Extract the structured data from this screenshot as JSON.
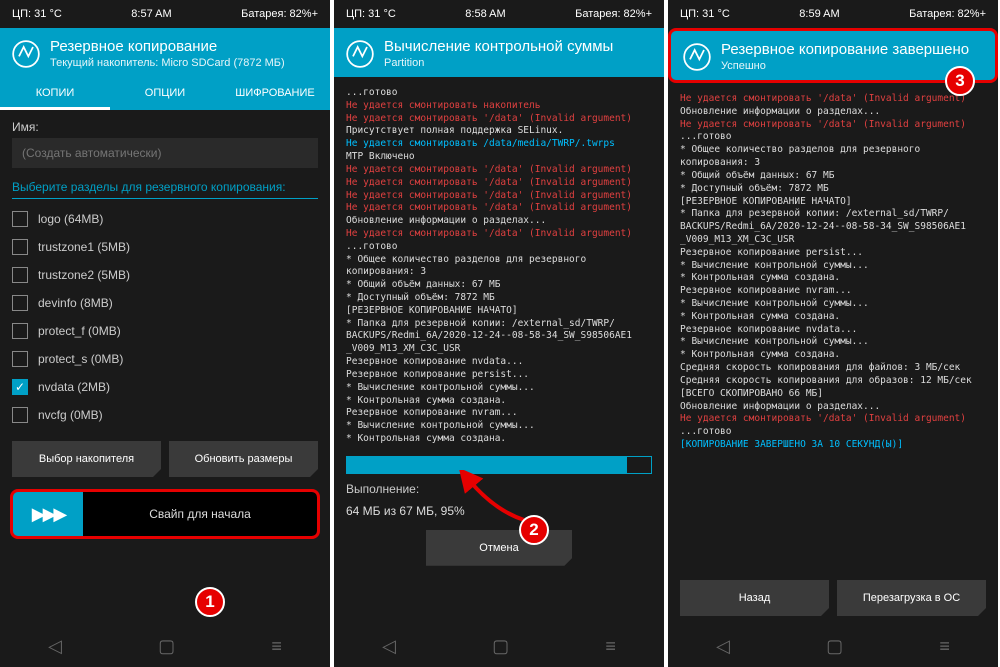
{
  "screens": [
    {
      "status": {
        "cpu": "ЦП: 31 °C",
        "time": "8:57 AM",
        "battery": "Батарея: 82%+"
      },
      "header": {
        "title": "Резервное копирование",
        "subtitle": "Текущий накопитель: Micro SDCard (7872 МБ)"
      },
      "tabs": [
        "КОПИИ",
        "ОПЦИИ",
        "ШИФРОВАНИЕ"
      ],
      "name_label": "Имя:",
      "name_placeholder": "(Создать автоматически)",
      "partitions_label": "Выберите разделы для резервного копирования:",
      "partitions": [
        {
          "label": "logo (64MB)",
          "checked": false
        },
        {
          "label": "trustzone1 (5MB)",
          "checked": false
        },
        {
          "label": "trustzone2 (5MB)",
          "checked": false
        },
        {
          "label": "devinfo (8MB)",
          "checked": false
        },
        {
          "label": "protect_f (0MB)",
          "checked": false
        },
        {
          "label": "protect_s (0MB)",
          "checked": false
        },
        {
          "label": "nvdata (2MB)",
          "checked": true
        },
        {
          "label": "nvcfg (0MB)",
          "checked": false
        }
      ],
      "buttons": {
        "storage": "Выбор накопителя",
        "refresh": "Обновить размеры"
      },
      "swipe_label": "Свайп для начала"
    },
    {
      "status": {
        "cpu": "ЦП: 31 °C",
        "time": "8:58 AM",
        "battery": "Батарея: 82%+"
      },
      "header": {
        "title": "Вычисление контрольной суммы",
        "subtitle": "Partition"
      },
      "log": [
        {
          "c": "white",
          "t": "...готово"
        },
        {
          "c": "red",
          "t": "Не удается смонтировать накопитель"
        },
        {
          "c": "red",
          "t": "Не удается смонтировать '/data' (Invalid argument)"
        },
        {
          "c": "white",
          "t": "Присутствует полная поддержка SELinux."
        },
        {
          "c": "cyan",
          "t": "Не удается смонтировать /data/media/TWRP/.twrps"
        },
        {
          "c": "white",
          "t": "MTP Включено"
        },
        {
          "c": "red",
          "t": "Не удается смонтировать '/data' (Invalid argument)"
        },
        {
          "c": "red",
          "t": "Не удается смонтировать '/data' (Invalid argument)"
        },
        {
          "c": "red",
          "t": "Не удается смонтировать '/data' (Invalid argument)"
        },
        {
          "c": "red",
          "t": "Не удается смонтировать '/data' (Invalid argument)"
        },
        {
          "c": "white",
          "t": "Обновление информации о разделах..."
        },
        {
          "c": "red",
          "t": "Не удается смонтировать '/data' (Invalid argument)"
        },
        {
          "c": "white",
          "t": "...готово"
        },
        {
          "c": "white",
          "t": " * Общее количество разделов для резервного"
        },
        {
          "c": "white",
          "t": "копирования: 3"
        },
        {
          "c": "white",
          "t": " * Общий объём данных: 67 МБ"
        },
        {
          "c": "white",
          "t": " * Доступный объём: 7872 МБ"
        },
        {
          "c": "white",
          "t": "[РЕЗЕРВНОЕ КОПИРОВАНИЕ НАЧАТО]"
        },
        {
          "c": "white",
          "t": " * Папка для резервной копии: /external_sd/TWRP/"
        },
        {
          "c": "white",
          "t": "BACKUPS/Redmi_6A/2020-12-24--08-58-34_SW_S98506AE1"
        },
        {
          "c": "white",
          "t": "_V009_M13_XM_C3C_USR"
        },
        {
          "c": "white",
          "t": "Резервное копирование nvdata..."
        },
        {
          "c": "white",
          "t": "Резервное копирование persist..."
        },
        {
          "c": "white",
          "t": " * Вычисление контрольной суммы..."
        },
        {
          "c": "white",
          "t": " * Контрольная сумма создана."
        },
        {
          "c": "white",
          "t": "Резервное копирование nvram..."
        },
        {
          "c": "white",
          "t": " * Вычисление контрольной суммы..."
        },
        {
          "c": "white",
          "t": " * Контрольная сумма создана."
        }
      ],
      "exec_label": "Выполнение:",
      "exec_stats": "64 МБ из 67 МБ, 95%",
      "cancel": "Отмена"
    },
    {
      "status": {
        "cpu": "ЦП: 31 °C",
        "time": "8:59 AM",
        "battery": "Батарея: 82%+"
      },
      "header": {
        "title": "Резервное копирование завершено",
        "subtitle": "Успешно"
      },
      "log": [
        {
          "c": "red",
          "t": "Не удается смонтировать '/data' (Invalid argument)"
        },
        {
          "c": "white",
          "t": "Обновление информации о разделах..."
        },
        {
          "c": "red",
          "t": "Не удается смонтировать '/data' (Invalid argument)"
        },
        {
          "c": "white",
          "t": "...готово"
        },
        {
          "c": "white",
          "t": " * Общее количество разделов для резервного"
        },
        {
          "c": "white",
          "t": "копирования: 3"
        },
        {
          "c": "white",
          "t": " * Общий объём данных: 67 МБ"
        },
        {
          "c": "white",
          "t": " * Доступный объём: 7872 МБ"
        },
        {
          "c": "white",
          "t": "[РЕЗЕРВНОЕ КОПИРОВАНИЕ НАЧАТО]"
        },
        {
          "c": "white",
          "t": " * Папка для резервной копии: /external_sd/TWRP/"
        },
        {
          "c": "white",
          "t": "BACKUPS/Redmi_6A/2020-12-24--08-58-34_SW_S98506AE1"
        },
        {
          "c": "white",
          "t": "_V009_M13_XM_C3C_USR"
        },
        {
          "c": "white",
          "t": "Резервное копирование persist..."
        },
        {
          "c": "white",
          "t": " * Вычисление контрольной суммы..."
        },
        {
          "c": "white",
          "t": " * Контрольная сумма создана."
        },
        {
          "c": "white",
          "t": "Резервное копирование nvram..."
        },
        {
          "c": "white",
          "t": " * Вычисление контрольной суммы..."
        },
        {
          "c": "white",
          "t": " * Контрольная сумма создана."
        },
        {
          "c": "white",
          "t": "Резервное копирование nvdata..."
        },
        {
          "c": "white",
          "t": " * Вычисление контрольной суммы..."
        },
        {
          "c": "white",
          "t": " * Контрольная сумма создана."
        },
        {
          "c": "white",
          "t": "Средняя скорость копирования для файлов: 3 МБ/сек"
        },
        {
          "c": "white",
          "t": "Средняя скорость копирования для образов: 12 МБ/сек"
        },
        {
          "c": "white",
          "t": "[ВСЕГО СКОПИРОВАНО 66 МБ]"
        },
        {
          "c": "white",
          "t": "Обновление информации о разделах..."
        },
        {
          "c": "red",
          "t": "Не удается смонтировать '/data' (Invalid argument)"
        },
        {
          "c": "white",
          "t": "...готово"
        },
        {
          "c": "cyan",
          "t": "[КОПИРОВАНИЕ ЗАВЕРШЕНО ЗА 10 СЕКУНД(Ы)]"
        }
      ],
      "back": "Назад",
      "reboot": "Перезагрузка в ОС"
    }
  ],
  "badges": [
    "1",
    "2",
    "3"
  ]
}
